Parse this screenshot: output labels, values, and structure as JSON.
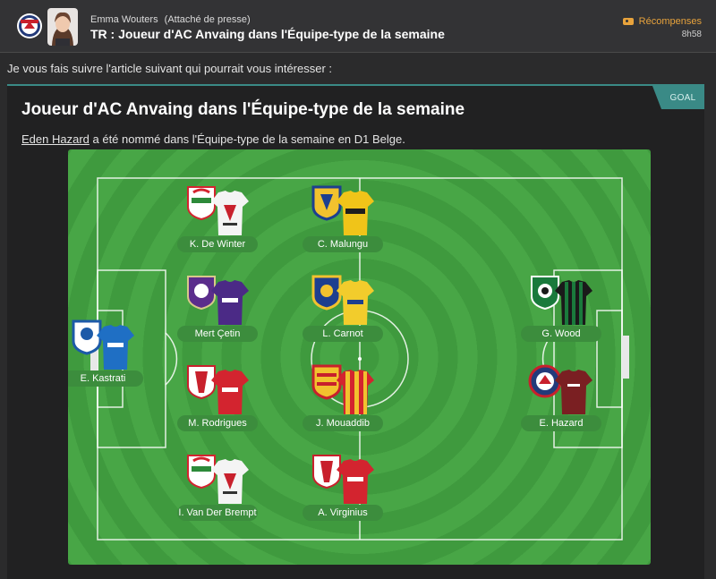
{
  "header": {
    "sender_name": "Emma Wouters",
    "sender_role": "(Attaché de presse)",
    "subject": "TR : Joueur d'AC Anvaing dans l'Équipe-type de la semaine",
    "rewards_label": "Récompenses",
    "time": "8h58",
    "club_badge_text": "ANVAING"
  },
  "intro": "Je vous fais suivre l'article suivant qui pourrait vous intéresser :",
  "article": {
    "tag": "GOAL",
    "title": "Joueur d'AC Anvaing dans l'Équipe-type de la semaine",
    "lead_player": "Eden Hazard",
    "lead_text": " a été nommé dans l'Équipe-type de la semaine en D1 Belge."
  },
  "team": [
    {
      "name": "K. De Winter",
      "kit": "zulte"
    },
    {
      "name": "C. Malungu",
      "kit": "stvv"
    },
    {
      "name": "Mert Çetin",
      "kit": "anderlecht"
    },
    {
      "name": "L. Carnot",
      "kit": "union"
    },
    {
      "name": "G. Wood",
      "kit": "cercle"
    },
    {
      "name": "E. Kastrati",
      "kit": "gent"
    },
    {
      "name": "M. Rodrigues",
      "kit": "standard"
    },
    {
      "name": "J. Mouaddib",
      "kit": "mechelen"
    },
    {
      "name": "E. Hazard",
      "kit": "anvaing"
    },
    {
      "name": "I. Van Der Brempt",
      "kit": "zulte"
    },
    {
      "name": "A. Virginius",
      "kit": "standard"
    }
  ],
  "colors": {
    "accent": "#3a8a86",
    "rewards": "#e8a33c",
    "pitch_dark": "#3f9a3e",
    "pitch_light": "#48a646"
  }
}
